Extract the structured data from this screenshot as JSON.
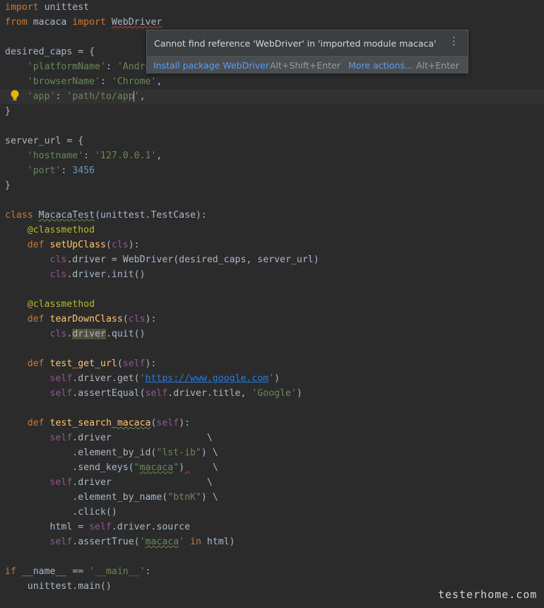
{
  "editor": {
    "lines": [
      "import unittest",
      "from macaca import WebDriver",
      "",
      "desired_caps = {",
      "    'platformName': 'Android',",
      "    'browserName': 'Chrome',",
      "    'app': 'path/to/app',",
      "}",
      "",
      "server_url = {",
      "    'hostname': '127.0.0.1',",
      "    'port': 3456",
      "}",
      "",
      "class MacacaTest(unittest.TestCase):",
      "    @classmethod",
      "    def setUpClass(cls):",
      "        cls.driver = WebDriver(desired_caps, server_url)",
      "        cls.driver.init()",
      "",
      "    @classmethod",
      "    def tearDownClass(cls):",
      "        cls.driver.quit()",
      "",
      "    def test_get_url(self):",
      "        self.driver.get('https://www.google.com')",
      "        self.assertEqual(self.driver.title, 'Google')",
      "",
      "    def test_search_macaca(self):",
      "        self.driver                 \\",
      "            .element_by_id(\"lst-ib\") \\",
      "            .send_keys(\"macaca\")    \\",
      "        self.driver                 \\",
      "            .element_by_name(\"btnK\") \\",
      "            .click()",
      "        html = self.driver.source",
      "        self.assertTrue('macaca' in html)",
      "",
      "if __name__ == '__main__':",
      "    unittest.main()"
    ],
    "current_line": 7,
    "colors": {
      "background": "#2b2b2b",
      "keyword": "#cc7832",
      "string": "#6a8759",
      "number": "#6897bb",
      "self": "#94558d",
      "decorator": "#bbb529",
      "function": "#ffc66d",
      "error_underline": "#bc3f3c"
    }
  },
  "inspection_popup": {
    "message": "Cannot find reference 'WebDriver' in 'imported module macaca'",
    "more_icon": "more-vertical-icon",
    "action_install": "Install package WebDriver",
    "action_install_shortcut": "Alt+Shift+Enter",
    "action_more": "More actions...",
    "action_more_shortcut": "Alt+Enter"
  },
  "intention_bulb": "lightbulb-icon",
  "watermark": "testerhome.com"
}
